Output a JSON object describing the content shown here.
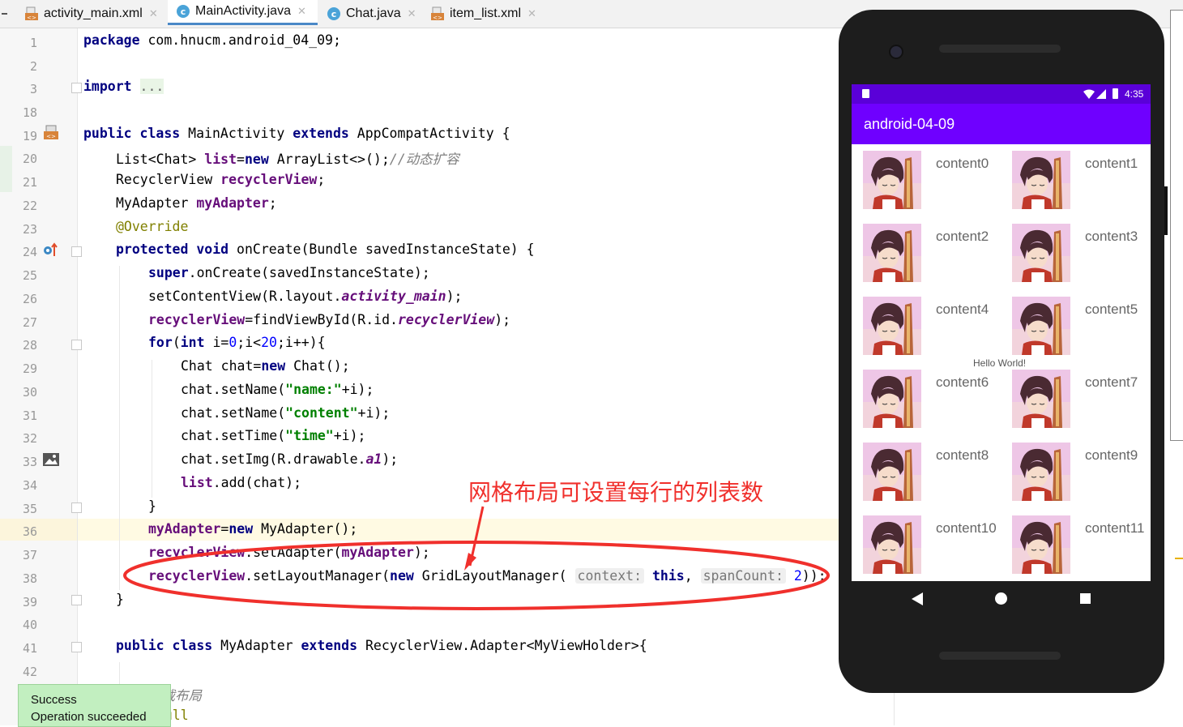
{
  "tabs": [
    {
      "label": "activity_main.xml",
      "kind": "xml-icon",
      "active": false
    },
    {
      "label": "MainActivity.java",
      "kind": "java-class-icon",
      "active": true
    },
    {
      "label": "Chat.java",
      "kind": "java-class-icon",
      "active": false
    },
    {
      "label": "item_list.xml",
      "kind": "xml-icon",
      "active": false
    }
  ],
  "line_numbers": [
    "1",
    "2",
    "3",
    "18",
    "19",
    "20",
    "21",
    "22",
    "23",
    "24",
    "25",
    "26",
    "27",
    "28",
    "29",
    "30",
    "31",
    "32",
    "33",
    "34",
    "35",
    "36",
    "37",
    "38",
    "39",
    "40",
    "41",
    "42"
  ],
  "code": {
    "l1_kw": "package",
    "l1_rest": " com.hnucm.android_04_09;",
    "l3_kw": "import",
    "l3_fold": "...",
    "l19_kw": "public class",
    "l19_name": " MainActivity ",
    "l19_kw2": "extends",
    "l19_rest": " AppCompatActivity {",
    "l20_a": "List<Chat> ",
    "l20_fld": "list",
    "l20_b": "=",
    "l20_kw": "new",
    "l20_c": " ArrayList<>();",
    "l20_cm": "//动态扩容",
    "l21_a": "RecyclerView ",
    "l21_fld": "recyclerView",
    "l21_b": ";",
    "l22_a": "MyAdapter ",
    "l22_fld": "myAdapter",
    "l22_b": ";",
    "l23_ann": "@Override",
    "l24_kw": "protected void",
    "l24_rest": " onCreate(Bundle savedInstanceState) {",
    "l25_kw": "super",
    "l25_rest": ".onCreate(savedInstanceState);",
    "l26_a": "setContentView(R.layout.",
    "l26_it": "activity_main",
    "l26_b": ");",
    "l27_fld": "recyclerView",
    "l27_a": "=findViewById(R.id.",
    "l27_it": "recyclerView",
    "l27_b": ");",
    "l28_kw": "for",
    "l28_a": "(",
    "l28_kw2": "int",
    "l28_b": " i=",
    "l28_n1": "0",
    "l28_c": ";i<",
    "l28_n2": "20",
    "l28_d": ";i++){",
    "l29_a": "Chat chat=",
    "l29_kw": "new",
    "l29_b": " Chat();",
    "l30_a": "chat.setName(",
    "l30_str": "\"name:\"",
    "l30_b": "+i);",
    "l31_a": "chat.setName(",
    "l31_str": "\"content\"",
    "l31_b": "+i);",
    "l32_a": "chat.setTime(",
    "l32_str": "\"time\"",
    "l32_b": "+i);",
    "l33_a": "chat.setImg(R.drawable.",
    "l33_it": "a1",
    "l33_b": ");",
    "l34_fld": "list",
    "l34_a": ".add(chat);",
    "l35": "}",
    "l36_fld": "myAdapter",
    "l36_a": "=",
    "l36_kw": "new",
    "l36_b": " MyAdapter();",
    "l37_fld": "recyclerView",
    "l37_a": ".setAdapter(",
    "l37_fld2": "myAdapter",
    "l37_b": ");",
    "l38_fld": "recyclerView",
    "l38_a": ".setLayoutManager(",
    "l38_kw": "new",
    "l38_b": " GridLayoutManager(",
    "l38_hint1": "context:",
    "l38_kw2": "this",
    "l38_c": ",",
    "l38_hint2": "spanCount:",
    "l38_n": "2",
    "l38_d": "));",
    "l39": "}",
    "l41_kw": "public class",
    "l41_a": " MyAdapter ",
    "l41_kw2": "extends",
    "l41_b": " RecyclerView.Adapter<MyViewHolder>{",
    "l43_cm": "加载布局",
    "l44_ann": "nNull"
  },
  "annotation_text": "网格布局可设置每行的列表数",
  "phone": {
    "status_time": "4:35",
    "app_title": "android-04-09",
    "hello": "Hello World!",
    "items": [
      "content0",
      "content1",
      "content2",
      "content3",
      "content4",
      "content5",
      "content6",
      "content7",
      "content8",
      "content9",
      "content10",
      "content11"
    ]
  },
  "toast": {
    "title": "Success",
    "message": "Operation succeeded"
  },
  "colors": {
    "accent": "#6f00ff",
    "statusbar": "#5a00d8",
    "annotation": "#f0302c",
    "toast_bg": "#c2efc0"
  }
}
